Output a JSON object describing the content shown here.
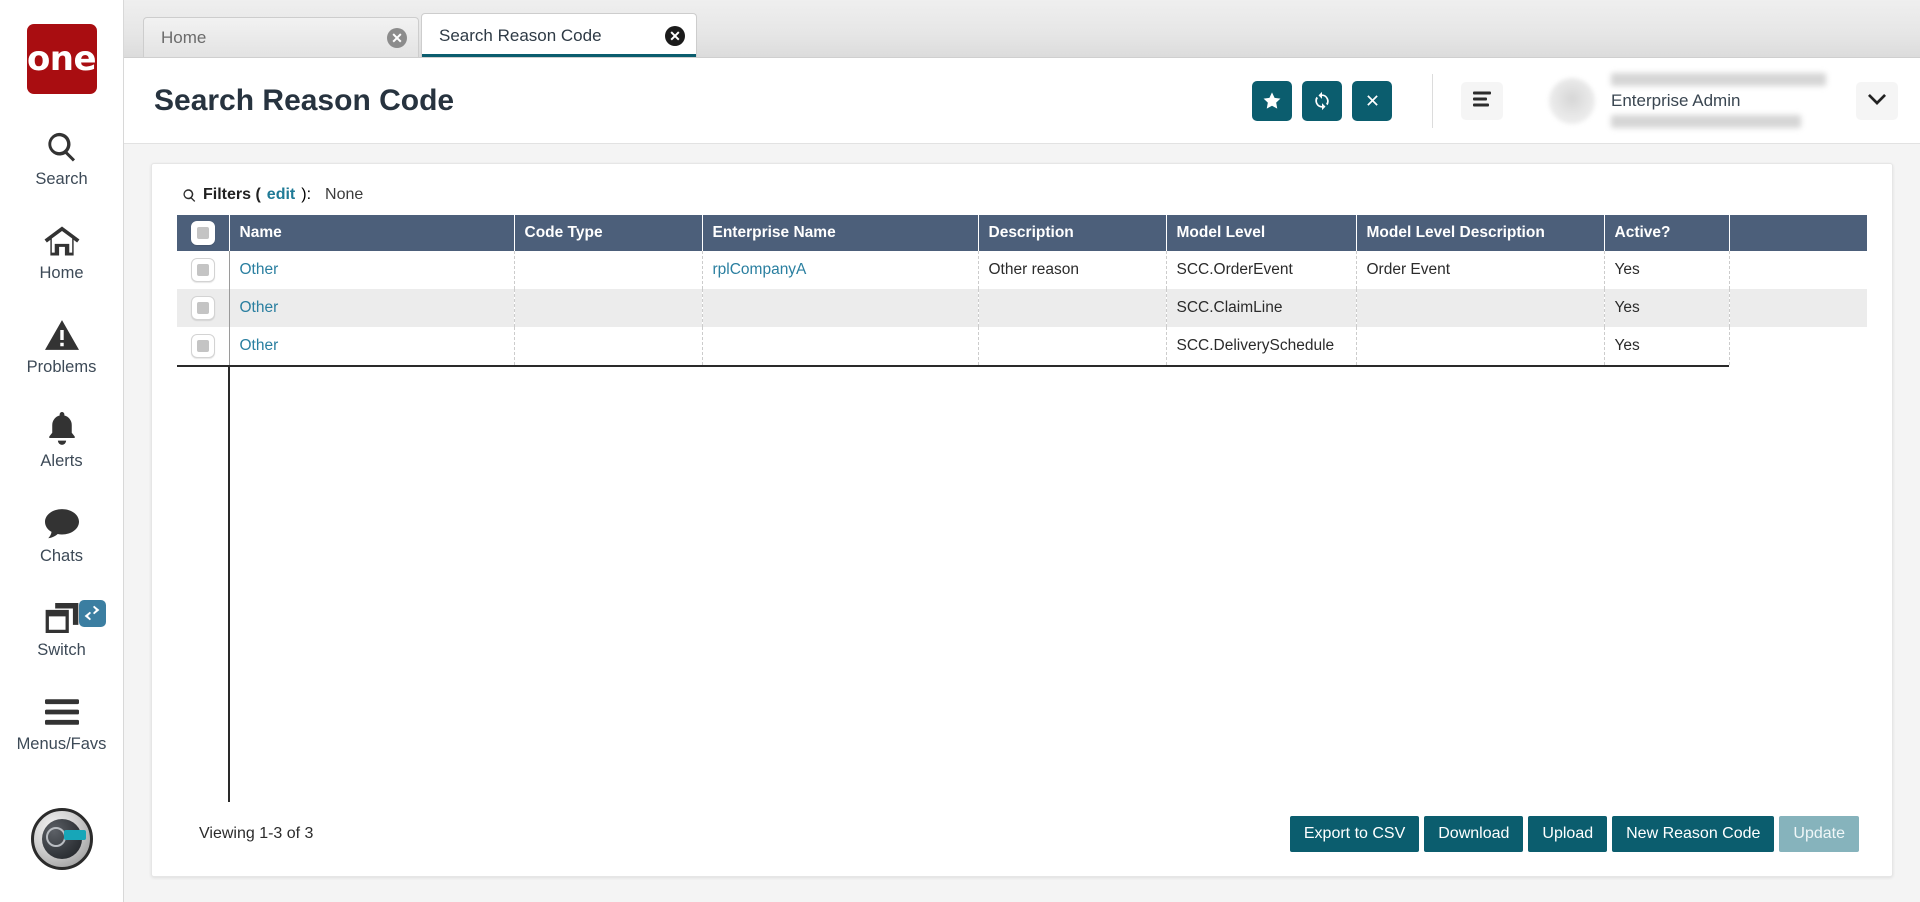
{
  "brand": {
    "logo_text": "one",
    "logo_color": "#a90d11"
  },
  "theme": {
    "accent": "#0b5d6e",
    "table_header": "#4c5f7a",
    "link": "#2a7fa0",
    "badge": "#3b7ea1"
  },
  "rail": {
    "items": [
      {
        "label": "Search",
        "icon": "search-icon"
      },
      {
        "label": "Home",
        "icon": "home-icon"
      },
      {
        "label": "Problems",
        "icon": "warning-triangle-icon"
      },
      {
        "label": "Alerts",
        "icon": "bell-icon"
      },
      {
        "label": "Chats",
        "icon": "chat-bubble-icon"
      },
      {
        "label": "Switch",
        "icon": "switch-windows-icon",
        "badge_icon": "swap-arrows-icon"
      },
      {
        "label": "Menus/Favs",
        "icon": "hamburger-icon"
      }
    ],
    "assistant_icon": "assistant-avatar-icon"
  },
  "tabs": [
    {
      "label": "Home",
      "active": false,
      "close_icon": "close-circle-icon"
    },
    {
      "label": "Search Reason Code",
      "active": true,
      "close_icon": "close-circle-icon"
    }
  ],
  "header": {
    "title": "Search Reason Code",
    "actions": [
      {
        "name": "favorite-button",
        "icon": "star-icon"
      },
      {
        "name": "refresh-button",
        "icon": "refresh-icon"
      },
      {
        "name": "close-button",
        "icon": "x-icon"
      }
    ],
    "menu_icon": "hamburger-icon",
    "avatar_icon": "user-avatar",
    "user_role": "Enterprise Admin",
    "user_name_redacted": "",
    "user_org_redacted": "",
    "caret_icon": "chevron-down-icon"
  },
  "filters": {
    "icon": "search-icon",
    "label": "Filters (",
    "edit_label": "edit",
    "label_end": "):",
    "value": "None"
  },
  "table": {
    "select_all_checkbox": "select-all-checkbox",
    "columns": [
      "Name",
      "Code Type",
      "Enterprise Name",
      "Description",
      "Model Level",
      "Model Level Description",
      "Active?"
    ],
    "rows": [
      {
        "name": "Other",
        "code_type": "",
        "enterprise_name": "rplCompanyA",
        "description": "Other reason",
        "model_level": "SCC.OrderEvent",
        "model_level_description": "Order Event",
        "active": "Yes"
      },
      {
        "name": "Other",
        "code_type": "",
        "enterprise_name": "",
        "description": "",
        "model_level": "SCC.ClaimLine",
        "model_level_description": "",
        "active": "Yes"
      },
      {
        "name": "Other",
        "code_type": "",
        "enterprise_name": "",
        "description": "",
        "model_level": "SCC.DeliverySchedule",
        "model_level_description": "",
        "active": "Yes"
      }
    ]
  },
  "footer": {
    "viewing": "Viewing 1-3 of 3",
    "buttons": [
      {
        "label": "Export to CSV",
        "name": "export-to-csv-button",
        "disabled": false
      },
      {
        "label": "Download",
        "name": "download-button",
        "disabled": false
      },
      {
        "label": "Upload",
        "name": "upload-button",
        "disabled": false
      },
      {
        "label": "New Reason Code",
        "name": "new-reason-code-button",
        "disabled": false
      },
      {
        "label": "Update",
        "name": "update-button",
        "disabled": true
      }
    ]
  }
}
